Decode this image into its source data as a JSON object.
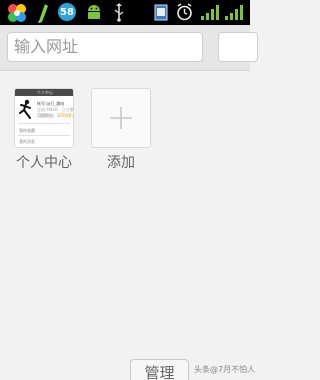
{
  "status_bar": {
    "badge_58": "58",
    "icons": [
      "app-flower-icon",
      "pen-icon",
      "badge-58-icon",
      "android-icon",
      "usb-icon",
      "sms-icon",
      "alarm-icon",
      "signal-icon",
      "signal-icon"
    ]
  },
  "address_bar": {
    "placeholder": "输入网址"
  },
  "tiles": [
    {
      "label": "个人中心",
      "preview": {
        "header": "个人中心",
        "line1": "帐号:@打_趣味",
        "line2": "注册:MBEB · 已注册",
        "line3_prefix": "可用积分：",
        "line3_value": "329点积",
        "line4": "我的收藏",
        "line5": "我的消息"
      }
    },
    {
      "label": "添加"
    }
  ],
  "footer": {
    "manage_label": "管理",
    "watermark": "头条@7月不怕人"
  },
  "colors": {
    "status_bar_bg": "#000000",
    "page_bg": "#f2f2f2",
    "accent_orange": "#f08a00"
  }
}
